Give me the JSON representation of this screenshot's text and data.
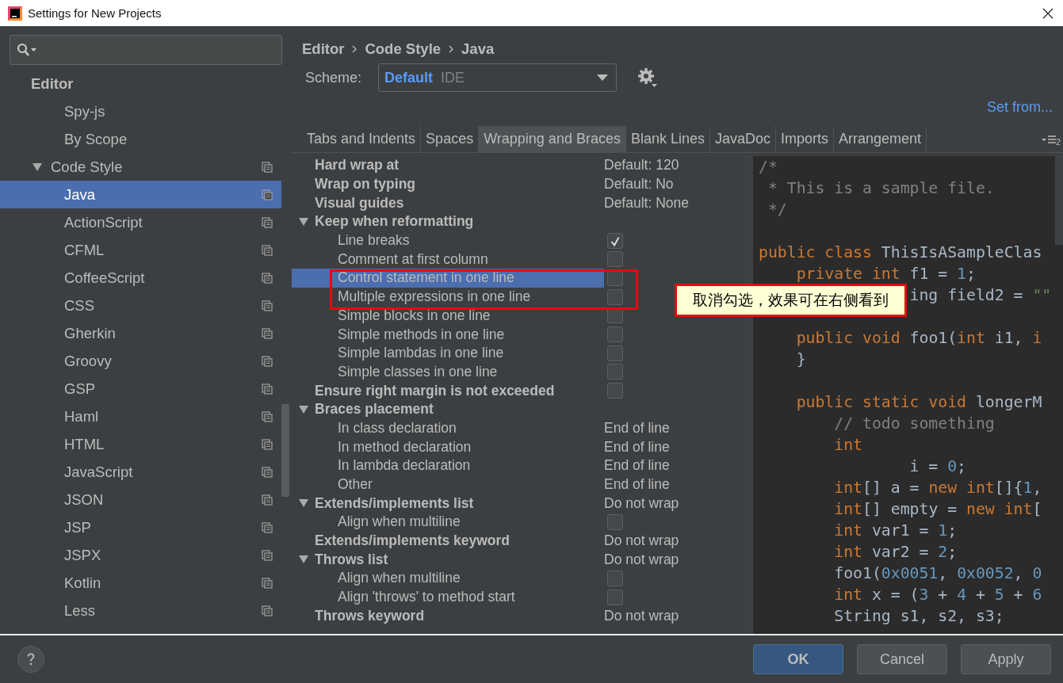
{
  "window": {
    "title": "Settings for New Projects"
  },
  "sidebar": {
    "items": [
      {
        "label": "Editor",
        "kind": "header",
        "selected": false,
        "scheme_icon": false,
        "children": [
          {
            "label": "Spy-js",
            "kind": "item",
            "selected": false,
            "scheme_icon": false
          },
          {
            "label": "By Scope",
            "kind": "item",
            "selected": false,
            "scheme_icon": false
          },
          {
            "label": "Code Style",
            "kind": "item",
            "selected": false,
            "scheme_icon": true,
            "expanded": true,
            "children": [
              {
                "label": "Java",
                "kind": "item",
                "selected": true,
                "scheme_icon": true
              },
              {
                "label": "ActionScript",
                "kind": "item",
                "selected": false,
                "scheme_icon": true
              },
              {
                "label": "CFML",
                "kind": "item",
                "selected": false,
                "scheme_icon": true
              },
              {
                "label": "CoffeeScript",
                "kind": "item",
                "selected": false,
                "scheme_icon": true
              },
              {
                "label": "CSS",
                "kind": "item",
                "selected": false,
                "scheme_icon": true
              },
              {
                "label": "Gherkin",
                "kind": "item",
                "selected": false,
                "scheme_icon": true
              },
              {
                "label": "Groovy",
                "kind": "item",
                "selected": false,
                "scheme_icon": true
              },
              {
                "label": "GSP",
                "kind": "item",
                "selected": false,
                "scheme_icon": true
              },
              {
                "label": "Haml",
                "kind": "item",
                "selected": false,
                "scheme_icon": true
              },
              {
                "label": "HTML",
                "kind": "item",
                "selected": false,
                "scheme_icon": true
              },
              {
                "label": "JavaScript",
                "kind": "item",
                "selected": false,
                "scheme_icon": true
              },
              {
                "label": "JSON",
                "kind": "item",
                "selected": false,
                "scheme_icon": true
              },
              {
                "label": "JSP",
                "kind": "item",
                "selected": false,
                "scheme_icon": true
              },
              {
                "label": "JSPX",
                "kind": "item",
                "selected": false,
                "scheme_icon": true
              },
              {
                "label": "Kotlin",
                "kind": "item",
                "selected": false,
                "scheme_icon": true
              },
              {
                "label": "Less",
                "kind": "item",
                "selected": false,
                "scheme_icon": true
              }
            ]
          }
        ]
      }
    ]
  },
  "breadcrumb": [
    "Editor",
    "Code Style",
    "Java"
  ],
  "scheme": {
    "label": "Scheme:",
    "value": "Default",
    "scope": "IDE"
  },
  "set_from": "Set from...",
  "tabs": [
    {
      "label": "Tabs and Indents",
      "selected": false
    },
    {
      "label": "Spaces",
      "selected": false
    },
    {
      "label": "Wrapping and Braces",
      "selected": true
    },
    {
      "label": "Blank Lines",
      "selected": false
    },
    {
      "label": "JavaDoc",
      "selected": false
    },
    {
      "label": "Imports",
      "selected": false
    },
    {
      "label": "Arrangement",
      "selected": false
    }
  ],
  "tab_overflow_count": "2",
  "options": [
    {
      "label": "Hard wrap at",
      "kind": "value",
      "value": "Default: 120",
      "selected": false
    },
    {
      "label": "Wrap on typing",
      "kind": "value",
      "value": "Default: No",
      "selected": false
    },
    {
      "label": "Visual guides",
      "kind": "value",
      "value": "Default: None",
      "selected": false
    },
    {
      "label": "Keep when reformatting",
      "kind": "heading",
      "selected": false,
      "expanded": true,
      "children": [
        {
          "label": "Line breaks",
          "kind": "checkbox",
          "checked": true,
          "selected": false
        },
        {
          "label": "Comment at first column",
          "kind": "checkbox",
          "checked": false,
          "selected": false
        },
        {
          "label": "Control statement in one line",
          "kind": "checkbox",
          "checked": false,
          "selected": true
        },
        {
          "label": "Multiple expressions in one line",
          "kind": "checkbox",
          "checked": false,
          "selected": false
        },
        {
          "label": "Simple blocks in one line",
          "kind": "checkbox",
          "checked": false,
          "selected": false
        },
        {
          "label": "Simple methods in one line",
          "kind": "checkbox",
          "checked": false,
          "selected": false
        },
        {
          "label": "Simple lambdas in one line",
          "kind": "checkbox",
          "checked": false,
          "selected": false
        },
        {
          "label": "Simple classes in one line",
          "kind": "checkbox",
          "checked": false,
          "selected": false
        }
      ]
    },
    {
      "label": "Ensure right margin is not exceeded",
      "kind": "checkbox",
      "checked": false,
      "selected": false
    },
    {
      "label": "Braces placement",
      "kind": "heading",
      "selected": false,
      "expanded": true,
      "children": [
        {
          "label": "In class declaration",
          "kind": "value",
          "value": "End of line",
          "selected": false
        },
        {
          "label": "In method declaration",
          "kind": "value",
          "value": "End of line",
          "selected": false
        },
        {
          "label": "In lambda declaration",
          "kind": "value",
          "value": "End of line",
          "selected": false
        },
        {
          "label": "Other",
          "kind": "value",
          "value": "End of line",
          "selected": false
        }
      ]
    },
    {
      "label": "Extends/implements list",
      "kind": "value",
      "value": "Do not wrap",
      "selected": false,
      "expanded": true,
      "children": [
        {
          "label": "Align when multiline",
          "kind": "checkbox",
          "checked": false,
          "selected": false
        }
      ]
    },
    {
      "label": "Extends/implements keyword",
      "kind": "value",
      "value": "Do not wrap",
      "selected": false
    },
    {
      "label": "Throws list",
      "kind": "value",
      "value": "Do not wrap",
      "selected": false,
      "expanded": true,
      "children": [
        {
          "label": "Align when multiline",
          "kind": "checkbox",
          "checked": false,
          "selected": false
        },
        {
          "label": "Align 'throws' to method start",
          "kind": "checkbox",
          "checked": false,
          "selected": false
        }
      ]
    },
    {
      "label": "Throws keyword",
      "kind": "value",
      "value": "Do not wrap",
      "selected": false
    }
  ],
  "code_preview": [
    {
      "kind": "code",
      "tokens": [
        {
          "kind": "comment",
          "text": "/*"
        }
      ]
    },
    {
      "kind": "code",
      "tokens": [
        {
          "kind": "comment",
          "text": " * This is a sample file."
        }
      ]
    },
    {
      "kind": "code",
      "tokens": [
        {
          "kind": "comment",
          "text": " */"
        }
      ]
    },
    {
      "kind": "blank"
    },
    {
      "kind": "code",
      "tokens": [
        {
          "kind": "keyword",
          "text": "public class "
        },
        {
          "kind": "plain",
          "text": "ThisIsASampleClas"
        }
      ]
    },
    {
      "kind": "code",
      "tokens": [
        {
          "kind": "keyword",
          "text": "    private int "
        },
        {
          "kind": "plain",
          "text": "f1 = "
        },
        {
          "kind": "number",
          "text": "1"
        },
        {
          "kind": "plain",
          "text": ";"
        }
      ]
    },
    {
      "kind": "code",
      "tokens": [
        {
          "kind": "plain",
          "text": "                ing field2 = "
        },
        {
          "kind": "string",
          "text": "\"\""
        }
      ]
    },
    {
      "kind": "blank"
    },
    {
      "kind": "code",
      "tokens": [
        {
          "kind": "keyword",
          "text": "    public void "
        },
        {
          "kind": "plain",
          "text": "foo1("
        },
        {
          "kind": "keyword",
          "text": "int "
        },
        {
          "kind": "plain",
          "text": "i1, "
        },
        {
          "kind": "keyword",
          "text": "i"
        }
      ]
    },
    {
      "kind": "code",
      "tokens": [
        {
          "kind": "plain",
          "text": "    }"
        }
      ]
    },
    {
      "kind": "blank"
    },
    {
      "kind": "code",
      "tokens": [
        {
          "kind": "keyword",
          "text": "    public static void "
        },
        {
          "kind": "plain",
          "text": "longerM"
        }
      ]
    },
    {
      "kind": "code",
      "tokens": [
        {
          "kind": "comment",
          "text": "        // todo something"
        }
      ]
    },
    {
      "kind": "code",
      "tokens": [
        {
          "kind": "keyword",
          "text": "        int"
        }
      ]
    },
    {
      "kind": "code",
      "tokens": [
        {
          "kind": "plain",
          "text": "                i = "
        },
        {
          "kind": "number",
          "text": "0"
        },
        {
          "kind": "plain",
          "text": ";"
        }
      ]
    },
    {
      "kind": "code",
      "tokens": [
        {
          "kind": "keyword",
          "text": "        int"
        },
        {
          "kind": "plain",
          "text": "[] a = "
        },
        {
          "kind": "keyword",
          "text": "new int"
        },
        {
          "kind": "plain",
          "text": "[]{"
        },
        {
          "kind": "number",
          "text": "1"
        },
        {
          "kind": "plain",
          "text": ","
        }
      ]
    },
    {
      "kind": "code",
      "tokens": [
        {
          "kind": "keyword",
          "text": "        int"
        },
        {
          "kind": "plain",
          "text": "[] empty = "
        },
        {
          "kind": "keyword",
          "text": "new int"
        },
        {
          "kind": "plain",
          "text": "["
        }
      ]
    },
    {
      "kind": "code",
      "tokens": [
        {
          "kind": "keyword",
          "text": "        int "
        },
        {
          "kind": "plain",
          "text": "var1 = "
        },
        {
          "kind": "number",
          "text": "1"
        },
        {
          "kind": "plain",
          "text": ";"
        }
      ]
    },
    {
      "kind": "code",
      "tokens": [
        {
          "kind": "keyword",
          "text": "        int "
        },
        {
          "kind": "plain",
          "text": "var2 = "
        },
        {
          "kind": "number",
          "text": "2"
        },
        {
          "kind": "plain",
          "text": ";"
        }
      ]
    },
    {
      "kind": "code",
      "tokens": [
        {
          "kind": "plain",
          "text": "        foo1("
        },
        {
          "kind": "number",
          "text": "0x0051"
        },
        {
          "kind": "plain",
          "text": ", "
        },
        {
          "kind": "number",
          "text": "0x0052"
        },
        {
          "kind": "plain",
          "text": ", "
        },
        {
          "kind": "number",
          "text": "0"
        }
      ]
    },
    {
      "kind": "code",
      "tokens": [
        {
          "kind": "keyword",
          "text": "        int "
        },
        {
          "kind": "plain",
          "text": "x = ("
        },
        {
          "kind": "number",
          "text": "3"
        },
        {
          "kind": "plain",
          "text": " + "
        },
        {
          "kind": "number",
          "text": "4"
        },
        {
          "kind": "plain",
          "text": " + "
        },
        {
          "kind": "number",
          "text": "5"
        },
        {
          "kind": "plain",
          "text": " + "
        },
        {
          "kind": "number",
          "text": "6"
        }
      ]
    },
    {
      "kind": "code",
      "tokens": [
        {
          "kind": "plain",
          "text": "        String s1, s2, s3;"
        }
      ]
    }
  ],
  "annotation": {
    "text": "取消勾选，效果可在右侧看到"
  },
  "buttons": [
    {
      "label": "OK",
      "kind": "primary"
    },
    {
      "label": "Cancel",
      "kind": "normal"
    },
    {
      "label": "Apply",
      "kind": "normal"
    }
  ]
}
